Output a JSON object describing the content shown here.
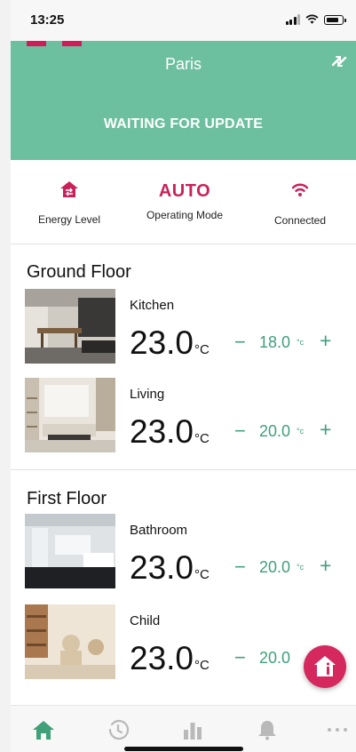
{
  "status_bar": {
    "time": "13:25"
  },
  "header": {
    "city": "Paris",
    "status_message": "WAITING FOR UPDATE"
  },
  "status_row": {
    "energy_label": "Energy Level",
    "mode_value": "AUTO",
    "mode_label": "Operating Mode",
    "connection_label": "Connected"
  },
  "sections": [
    {
      "title": "Ground Floor",
      "rooms": [
        {
          "name": "Kitchen",
          "temp": "23.0",
          "unit": "°C",
          "setpoint": "18.0",
          "set_unit": "°c"
        },
        {
          "name": "Living",
          "temp": "23.0",
          "unit": "°C",
          "setpoint": "20.0",
          "set_unit": "°c"
        }
      ]
    },
    {
      "title": "First Floor",
      "rooms": [
        {
          "name": "Bathroom",
          "temp": "23.0",
          "unit": "°C",
          "setpoint": "20.0",
          "set_unit": "°c"
        },
        {
          "name": "Child",
          "temp": "23.0",
          "unit": "°C",
          "setpoint": "20.0",
          "set_unit": ""
        }
      ]
    }
  ],
  "controls": {
    "minus": "−",
    "plus": "+"
  },
  "colors": {
    "accent_green": "#6cbf9f",
    "accent_pink": "#c9215b",
    "setpoint_green": "#3fa07a"
  },
  "icons": {
    "header": "sync-icon",
    "status": [
      "energy-level-icon",
      "wifi-icon"
    ],
    "fab": "home-info-icon",
    "tabs": [
      "home-icon",
      "history-icon",
      "stats-icon",
      "bell-icon",
      "more-icon"
    ]
  }
}
